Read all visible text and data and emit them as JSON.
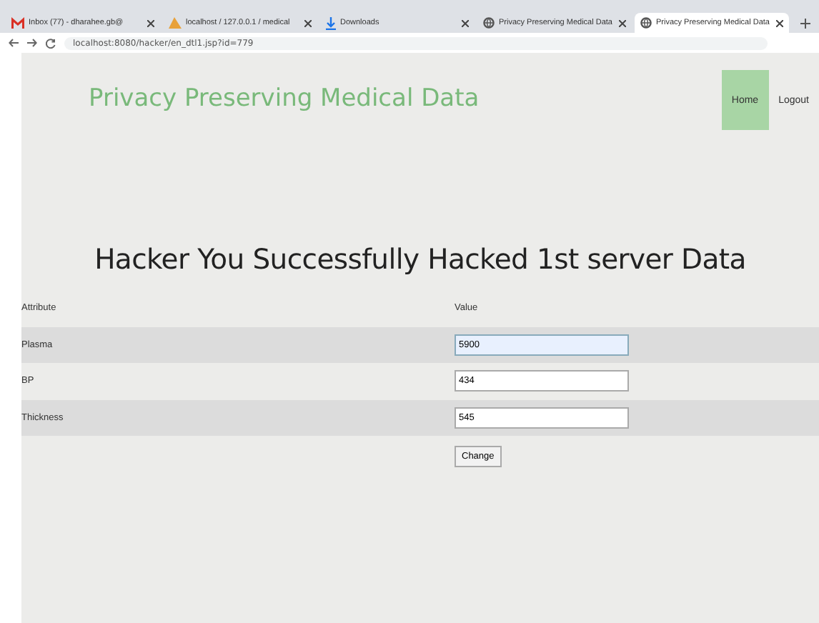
{
  "browser": {
    "tabs": [
      {
        "title": "Inbox (77) - dharahee.gb@",
        "selected": false
      },
      {
        "title": "localhost / 127.0.0.1 / medical",
        "selected": false
      },
      {
        "title": "Downloads",
        "selected": false
      },
      {
        "title": "Privacy Preserving Medical Data",
        "selected": false
      },
      {
        "title": "Privacy Preserving Medical Data",
        "selected": true
      }
    ],
    "address": "localhost:8080/hacker/en_dtl1.jsp?id=779"
  },
  "header": {
    "title": "Privacy Preserving Medical Data",
    "nav": [
      {
        "label": "Home",
        "selected": true
      },
      {
        "label": "Logout",
        "selected": false
      }
    ]
  },
  "heading": "Hacker You Successfully Hacked 1st server Data",
  "table": {
    "columns": [
      "Attribute",
      "Value"
    ],
    "rows": [
      {
        "attribute": "Plasma",
        "value": "5900",
        "highlighted": true
      },
      {
        "attribute": "BP",
        "value": "434",
        "highlighted": false
      },
      {
        "attribute": "Thickness",
        "value": "545",
        "highlighted": false
      }
    ]
  },
  "button": "Change"
}
